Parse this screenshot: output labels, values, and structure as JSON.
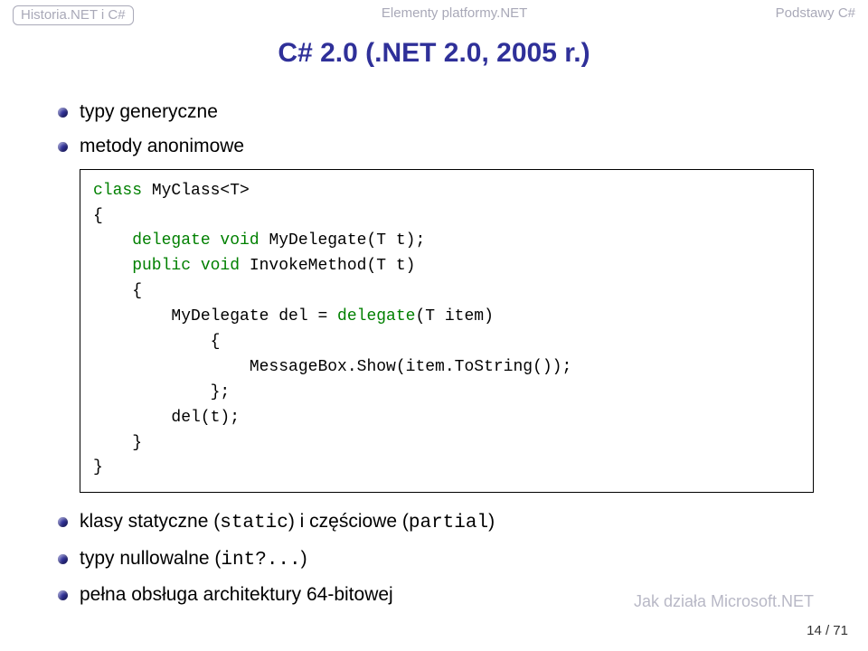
{
  "header": {
    "left_active": "Historia.NET i C#",
    "center": "Elementy platformy.NET",
    "right": "Podstawy C#"
  },
  "title": "C# 2.0 (.NET 2.0, 2005 r.)",
  "bullets": {
    "b1": "typy generyczne",
    "b2": "metody anonimowe",
    "b3_pre": "klasy statyczne (",
    "b3_code1": "static",
    "b3_mid": ") i częściowe (",
    "b3_code2": "partial",
    "b3_post": ")",
    "b4_pre": "typy nullowalne (",
    "b4_code": "int?...",
    "b4_post": ")",
    "b5": "pełna obsługa architektury 64-bitowej"
  },
  "code": {
    "l1a": "class",
    "l1b": " MyClass<T>",
    "l2": "{",
    "l3a": "    delegate void",
    "l3b": " MyDelegate(T t);",
    "l4a": "    public void",
    "l4b": " InvokeMethod(T t)",
    "l5": "    {",
    "l6a": "        MyDelegate del = ",
    "l6b": "delegate",
    "l6c": "(T item)",
    "l7": "            {",
    "l8": "                MessageBox.Show(item.ToString());",
    "l9": "            };",
    "l10": "        del(t);",
    "l11": "    }",
    "l12": "}"
  },
  "footer": {
    "brand": "Jak działa Microsoft.NET",
    "page": "14 / 71"
  }
}
